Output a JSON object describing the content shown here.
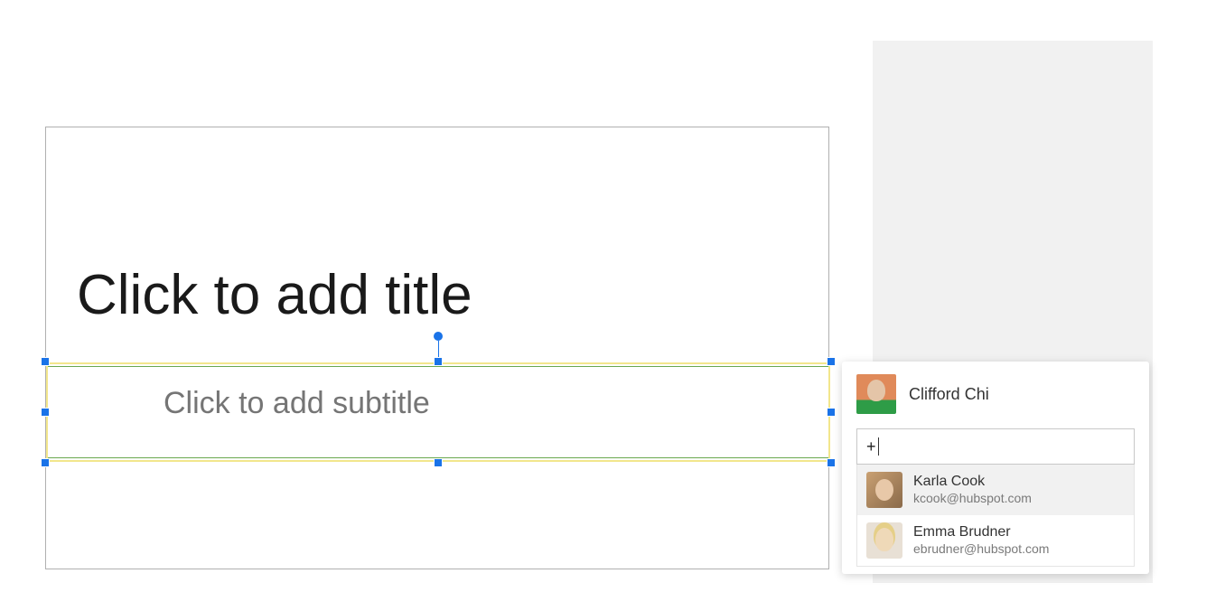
{
  "slide": {
    "title_placeholder": "Click to add title",
    "subtitle_placeholder": "Click to add subtitle"
  },
  "comment": {
    "author": "Clifford Chi",
    "input_value": "+",
    "suggestions": [
      {
        "name": "Karla Cook",
        "email": "kcook@hubspot.com",
        "highlighted": true
      },
      {
        "name": "Emma Brudner",
        "email": "ebrudner@hubspot.com",
        "highlighted": false
      }
    ]
  }
}
